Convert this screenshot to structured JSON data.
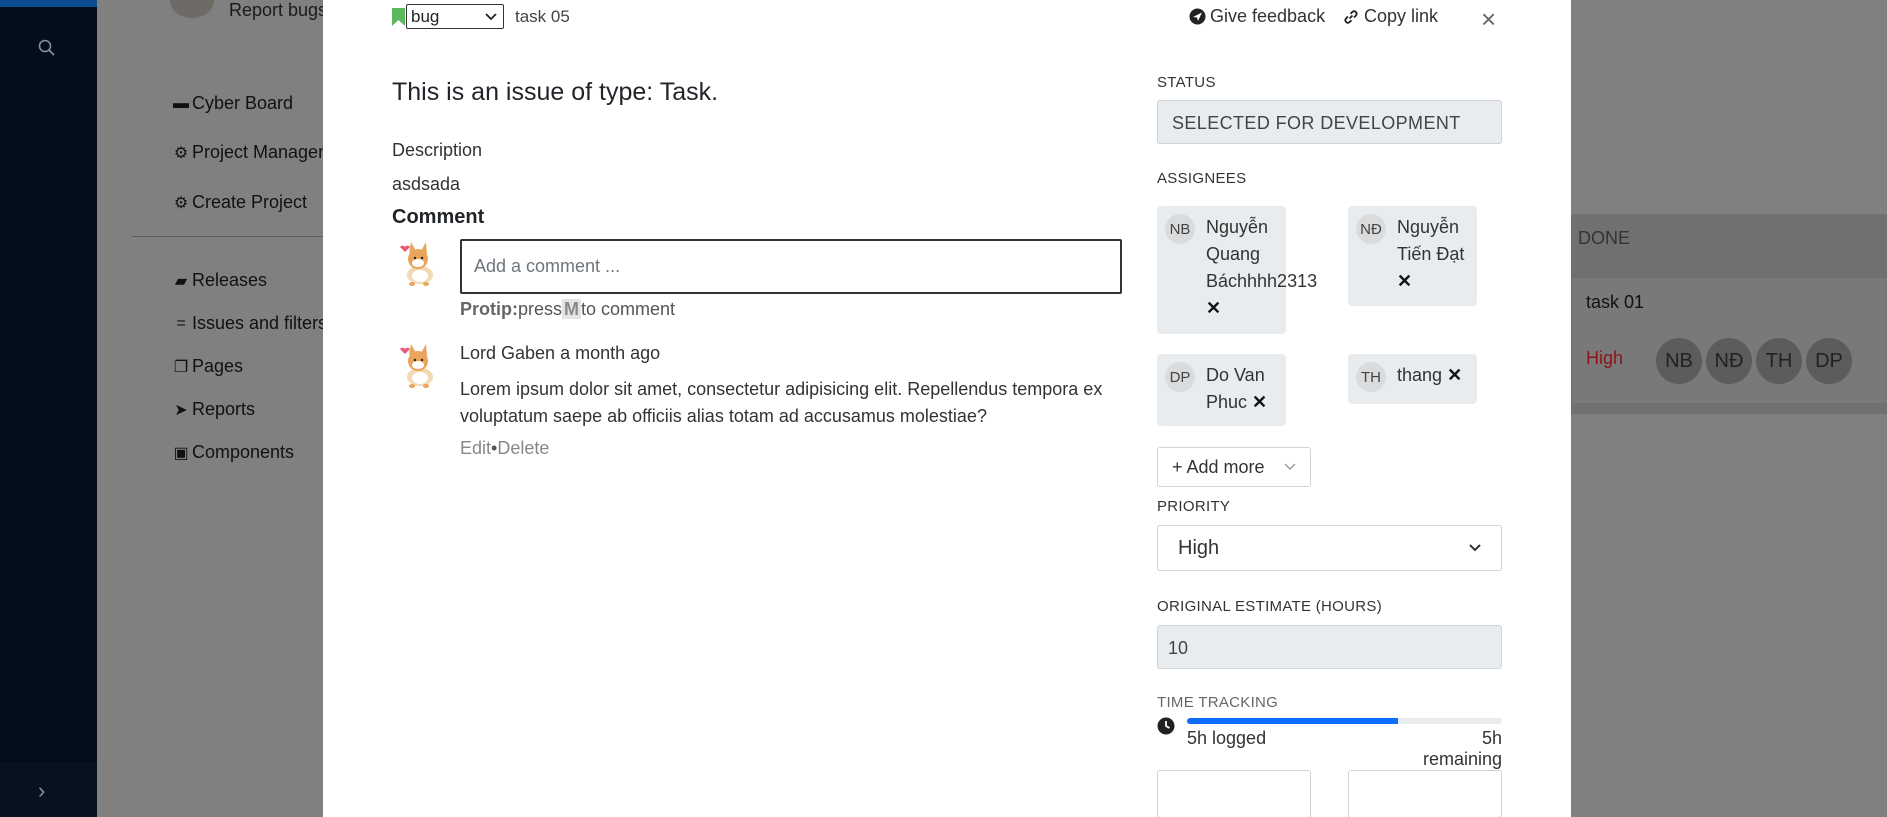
{
  "background": {
    "report_bugs": "Report bugs",
    "menu": [
      {
        "icon": "credit-card-icon",
        "label": "Cyber Board"
      },
      {
        "icon": "gear-icon",
        "label": "Project Managem"
      },
      {
        "icon": "gear-icon",
        "label": "Create Project"
      },
      {
        "icon": "truck-icon",
        "label": "Releases"
      },
      {
        "icon": "equals-icon",
        "label": "Issues and filters"
      },
      {
        "icon": "copy-icon",
        "label": "Pages"
      },
      {
        "icon": "location-arrow-icon",
        "label": "Reports"
      },
      {
        "icon": "box-icon",
        "label": "Components"
      }
    ],
    "done_column": {
      "title": "DONE",
      "card": {
        "name": "task 01",
        "priority": "High"
      },
      "avatars": [
        "NB",
        "NĐ",
        "TH",
        "DP"
      ]
    }
  },
  "modal": {
    "header": {
      "type_value": "bug",
      "task_id": "task 05",
      "feedback_label": "Give feedback",
      "copy_link_label": "Copy link",
      "close_label": "×"
    },
    "title": "This is an issue of type: Task.",
    "description_label": "Description",
    "description_text": "asdsada",
    "comment_heading": "Comment",
    "comment_placeholder": "Add a comment ...",
    "protip": {
      "label": "Protip:",
      "press": "press",
      "key": "M",
      "rest": "to comment"
    },
    "comments": [
      {
        "author": "Lord Gaben",
        "time": "a month ago",
        "body": "Lorem ipsum dolor sit amet, consectetur adipisicing elit. Repellendus tempora ex voluptatum saepe ab officiis alias totam ad accusamus molestiae?",
        "edit": "Edit",
        "sep": "•",
        "delete": "Delete"
      }
    ],
    "sidebar": {
      "status_label": "STATUS",
      "status_value": "SELECTED FOR DEVELOPMENT",
      "assignees_label": "ASSIGNEES",
      "assignees": [
        {
          "initials": "NB",
          "name_lines": [
            "Nguyễn",
            "Quang",
            "Báchhhh2313"
          ]
        },
        {
          "initials": "NĐ",
          "name_lines": [
            "Nguyễn",
            "Tiến Đạt"
          ]
        },
        {
          "initials": "DP",
          "name_lines": [
            "Do Van",
            "Phuc"
          ]
        },
        {
          "initials": "TH",
          "name_lines": [
            "thang"
          ]
        }
      ],
      "remove_symbol": "✕",
      "add_more_label": "+ Add more",
      "priority_label": "PRIORITY",
      "priority_value": "High",
      "estimate_label": "ORIGINAL ESTIMATE (HOURS)",
      "estimate_value": "10",
      "time_tracking_label": "TIME TRACKING",
      "time_tracking": {
        "logged": "5h logged",
        "remaining": "5h remaining",
        "progress_fraction": 0.67
      }
    }
  },
  "colors": {
    "rail": "#040d1a",
    "accent": "#0d6efd",
    "bug_flag": "#5cb85c",
    "priority_high": "#8c1414"
  }
}
